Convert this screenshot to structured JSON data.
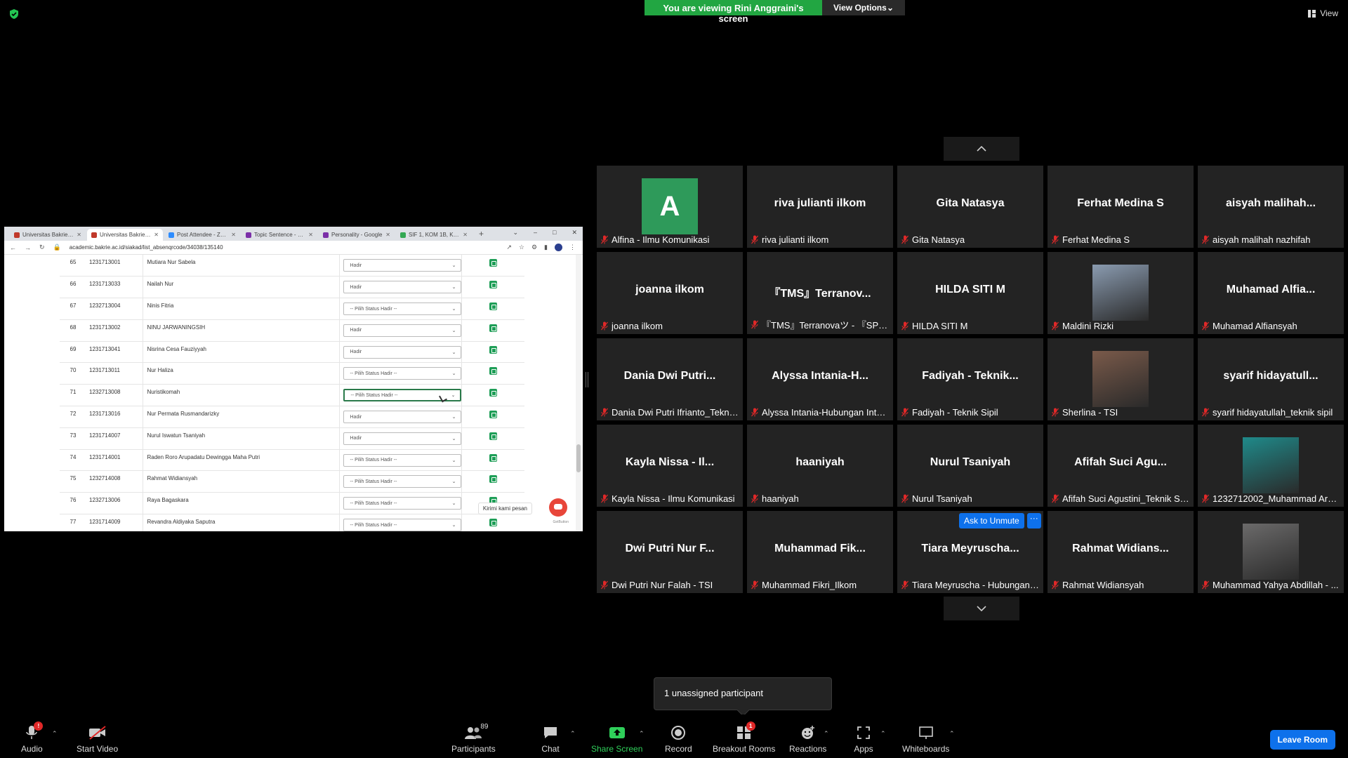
{
  "banner": {
    "viewing": "You are viewing Rini Anggraini's screen",
    "view_options": "View Options"
  },
  "top_right": {
    "view": "View"
  },
  "browser": {
    "tabs": [
      {
        "label": "Universitas Bakrie - SI",
        "color": "#c0392b",
        "active": false
      },
      {
        "label": "Universitas Bakrie - SI",
        "color": "#c0392b",
        "active": true
      },
      {
        "label": "Post Attendee - Zoom",
        "color": "#2d8cff",
        "active": false
      },
      {
        "label": "Topic Sentence - Goo",
        "color": "#7b2fa8",
        "active": false
      },
      {
        "label": "Personality - Google",
        "color": "#7b2fa8",
        "active": false
      },
      {
        "label": "SIF 1, KOM 1B, KOMIX",
        "color": "#34a853",
        "active": false
      }
    ],
    "url": "academic.bakrie.ac.id/siakad/list_absenqrcode/34038/135140"
  },
  "attendance": [
    {
      "no": "65",
      "nim": "1231713001",
      "name": "Mutiara Nur Sabela",
      "status": "Hadir"
    },
    {
      "no": "66",
      "nim": "1231713033",
      "name": "Nailah Nur",
      "status": "Hadir"
    },
    {
      "no": "67",
      "nim": "1232713004",
      "name": "Ninis Fitria",
      "status": "-- Pilih Status Hadir --"
    },
    {
      "no": "68",
      "nim": "1231713002",
      "name": "NINU JARWANINGSIH",
      "status": "Hadir"
    },
    {
      "no": "69",
      "nim": "1231713041",
      "name": "Nisrina Cesa Fauziyyah",
      "status": "Hadir"
    },
    {
      "no": "70",
      "nim": "1231713011",
      "name": "Nur Haliza",
      "status": "-- Pilih Status Hadir --"
    },
    {
      "no": "71",
      "nim": "1232713008",
      "name": "Nuristikomah",
      "status": "-- Pilih Status Hadir --"
    },
    {
      "no": "72",
      "nim": "1231713016",
      "name": "Nur Permata Rusmandarizky",
      "status": "Hadir"
    },
    {
      "no": "73",
      "nim": "1231714007",
      "name": "Nurul Iswatun Tsaniyah",
      "status": "Hadir"
    },
    {
      "no": "74",
      "nim": "1231714001",
      "name": "Raden Roro Arupadatu Dewingga Maha Putri",
      "status": "-- Pilih Status Hadir --"
    },
    {
      "no": "75",
      "nim": "1232714008",
      "name": "Rahmat Widiansyah",
      "status": "-- Pilih Status Hadir --"
    },
    {
      "no": "76",
      "nim": "1232713006",
      "name": "Raya Bagaskara",
      "status": "-- Pilih Status Hadir --"
    },
    {
      "no": "77",
      "nim": "1231714009",
      "name": "Revandra Aldiyaka Saputra",
      "status": "-- Pilih Status Hadir --"
    }
  ],
  "chat_widget": {
    "tooltip": "Kirimi kami pesan",
    "brand": "GetButton"
  },
  "participants": [
    {
      "display": "",
      "name": "Alfina - Ilmu Komunikasi",
      "avatar": "letter",
      "letter": "A"
    },
    {
      "display": "riva julianti ilkom",
      "name": "riva julianti ilkom",
      "avatar": "none"
    },
    {
      "display": "Gita Natasya",
      "name": "Gita Natasya",
      "avatar": "none"
    },
    {
      "display": "Ferhat Medina S",
      "name": "Ferhat Medina S",
      "avatar": "none"
    },
    {
      "display": "aisyah  malihah...",
      "name": "aisyah malihah nazhifah",
      "avatar": "none"
    },
    {
      "display": "joanna ilkom",
      "name": "joanna ilkom",
      "avatar": "none"
    },
    {
      "display": "『TMS』Terranov...",
      "name": "『TMS』Terranovaツ - 『SPEAK』",
      "avatar": "none"
    },
    {
      "display": "HILDA SITI M",
      "name": "HILDA SITI M",
      "avatar": "none"
    },
    {
      "display": "",
      "name": "Maldini Rizki",
      "avatar": "photo",
      "photo_color": "#8a9bb0"
    },
    {
      "display": "Muhamad  Alfia...",
      "name": "Muhamad Alfiansyah",
      "avatar": "none"
    },
    {
      "display": "Dania  Dwi  Putri...",
      "name": "Dania Dwi Putri Ifrianto_Teknik Sipil",
      "avatar": "none"
    },
    {
      "display": "Alyssa  Intania-H...",
      "name": "Alyssa Intania-Hubungan Internasional",
      "avatar": "none"
    },
    {
      "display": "Fadiyah  -  Teknik...",
      "name": "Fadiyah - Teknik Sipil",
      "avatar": "none"
    },
    {
      "display": "",
      "name": "Sherlina - TSI",
      "avatar": "photo",
      "photo_color": "#7a5a4a"
    },
    {
      "display": "syarif  hidayatull...",
      "name": "syarif hidayatullah_teknik sipil",
      "avatar": "none"
    },
    {
      "display": "Kayla  Nissa  -  Il...",
      "name": "Kayla Nissa - Ilmu Komunikasi",
      "avatar": "none"
    },
    {
      "display": "haaniyah",
      "name": "haaniyah",
      "avatar": "none"
    },
    {
      "display": "Nurul  Tsaniyah",
      "name": "Nurul Tsaniyah",
      "avatar": "none"
    },
    {
      "display": "Afifah  Suci  Agu...",
      "name": "Afifah Suci Agustini_Teknik Sipil",
      "avatar": "none"
    },
    {
      "display": "",
      "name": "1232712002_Muhammad Arma...",
      "avatar": "photo",
      "photo_color": "#1f8a8a"
    },
    {
      "display": "Dwi  Putri  Nur  F...",
      "name": "Dwi Putri Nur Falah - TSI",
      "avatar": "none"
    },
    {
      "display": "Muhammad  Fik...",
      "name": "Muhammad Fikri_Ilkom",
      "avatar": "none"
    },
    {
      "display": "Tiara  Meyruscha...",
      "name": "Tiara Meyruscha - Hubungan Internasional",
      "avatar": "none"
    },
    {
      "display": "Rahmat  Widians...",
      "name": "Rahmat Widiansyah",
      "avatar": "none"
    },
    {
      "display": "",
      "name": "Muhammad Yahya Abdillah - ...",
      "avatar": "photo",
      "photo_color": "#6b6a6a"
    }
  ],
  "ask_unmute": {
    "label": "Ask to Unmute",
    "more": "···"
  },
  "toast": {
    "text": "1 unassigned participant"
  },
  "toolbar": {
    "audio": "Audio",
    "audio_badge": "!",
    "start_video": "Start Video",
    "participants": "Participants",
    "participants_count": "89",
    "chat": "Chat",
    "share_screen": "Share Screen",
    "record": "Record",
    "breakout_rooms": "Breakout Rooms",
    "breakout_badge": "1",
    "reactions": "Reactions",
    "apps": "Apps",
    "whiteboards": "Whiteboards",
    "leave_room": "Leave Room"
  },
  "colors": {
    "accent": "#0e71eb",
    "green": "#22a642",
    "tile_bg": "#232323",
    "muted_red": "#e02828"
  }
}
